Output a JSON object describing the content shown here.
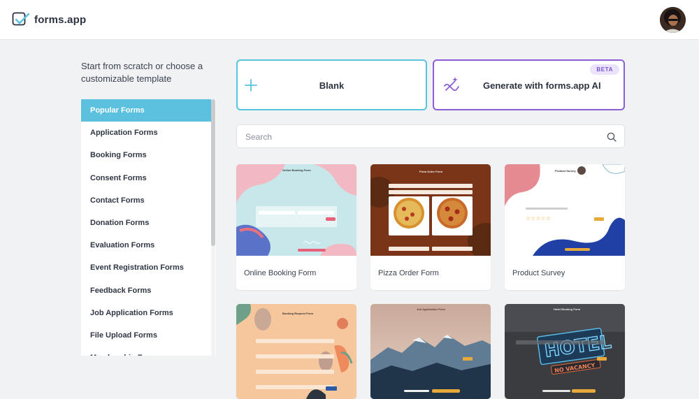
{
  "header": {
    "brand": "forms.app",
    "avatar_alt": "user-avatar"
  },
  "intro": {
    "text": "Start from scratch or choose a customizable template"
  },
  "sidebar": {
    "items": [
      {
        "label": "Popular Forms",
        "active": true
      },
      {
        "label": "Application Forms"
      },
      {
        "label": "Booking Forms"
      },
      {
        "label": "Consent Forms"
      },
      {
        "label": "Contact Forms"
      },
      {
        "label": "Donation Forms"
      },
      {
        "label": "Evaluation Forms"
      },
      {
        "label": "Event Registration Forms"
      },
      {
        "label": "Feedback Forms"
      },
      {
        "label": "Job Application Forms"
      },
      {
        "label": "File Upload Forms"
      },
      {
        "label": "Membership Forms"
      }
    ]
  },
  "actions": {
    "blank_label": "Blank",
    "ai_label": "Generate with forms.app AI",
    "beta_badge": "BETA"
  },
  "search": {
    "placeholder": "Search"
  },
  "templates": [
    {
      "label": "Online Booking Form",
      "thumb_title": "Online Booking Form"
    },
    {
      "label": "Pizza Order Form",
      "thumb_title": "Pizza Order Form"
    },
    {
      "label": "Product Survey",
      "thumb_title": "Product Survey"
    },
    {
      "label": "",
      "thumb_title": "Booking Request Form"
    },
    {
      "label": "",
      "thumb_title": "Job Application Form"
    },
    {
      "label": "",
      "thumb_title": "Hotel Booking Form"
    }
  ],
  "colors": {
    "accent_cyan": "#58c3dc",
    "accent_purple": "#8b5ed6",
    "sidebar_active": "#5bc1de"
  }
}
